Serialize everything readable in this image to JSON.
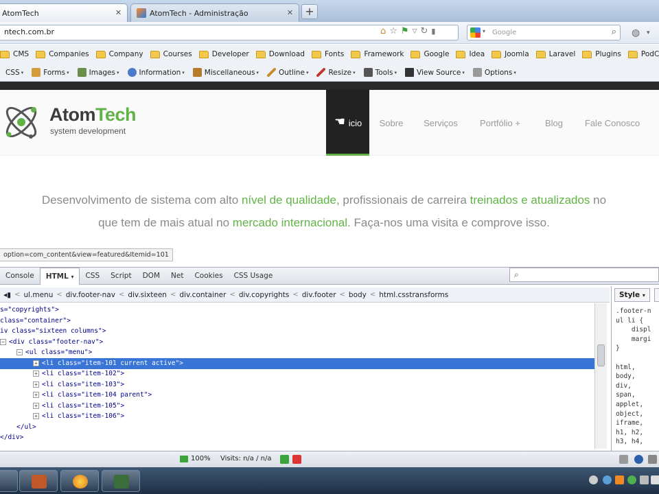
{
  "browser": {
    "tabs": [
      {
        "label": "AtomTech",
        "active": true
      },
      {
        "label": "AtomTech - Administração",
        "active": false
      }
    ],
    "new_tab": "+",
    "url": "ntech.com.br",
    "search_placeholder": "Google",
    "bookmarks": [
      "CMS",
      "Companies",
      "Company",
      "Courses",
      "Developer",
      "Download",
      "Fonts",
      "Framework",
      "Google",
      "Idea",
      "Joomla",
      "Laravel",
      "Plugins",
      "PodCast"
    ],
    "webdev_toolbar": [
      {
        "label": "CSS",
        "icon": "css-icon"
      },
      {
        "label": "Forms",
        "icon": "forms-icon"
      },
      {
        "label": "Images",
        "icon": "images-icon"
      },
      {
        "label": "Information",
        "icon": "information-icon"
      },
      {
        "label": "Miscellaneous",
        "icon": "miscellaneous-icon"
      },
      {
        "label": "Outline",
        "icon": "outline-icon"
      },
      {
        "label": "Resize",
        "icon": "resize-icon"
      },
      {
        "label": "Tools",
        "icon": "tools-icon"
      },
      {
        "label": "View Source",
        "icon": "view-source-icon"
      },
      {
        "label": "Options",
        "icon": "options-icon"
      }
    ]
  },
  "site": {
    "logo_title_dark": "Atom",
    "logo_title_green": "Tech",
    "logo_subtitle": "system development",
    "nav": [
      "Início",
      "Sobre",
      "Serviços",
      "Portfólio +",
      "Blog",
      "Fale Conosco"
    ],
    "nav_active_visible": "icio",
    "tagline": {
      "p1": "Desenvolvimento de sistema com alto ",
      "h1": "nível de qualidade",
      "p2": ", profissionais de carreira ",
      "h2": "treinados e atualizados",
      "p3": " no",
      "p4": "que tem de mais atual no ",
      "h3": "mercado internacional",
      "p5": ". Faça-nos uma visita e comprove isso."
    },
    "status_url": "option=com_content&view=featured&Itemid=101",
    "accent_color": "#62b347"
  },
  "firebug": {
    "tabs": [
      "Console",
      "HTML",
      "CSS",
      "Script",
      "DOM",
      "Net",
      "Cookies",
      "CSS Usage"
    ],
    "active_tab": "HTML",
    "breadcrumbs": [
      "ul.menu",
      "div.footer-nav",
      "div.sixteen",
      "div.container",
      "div.copyrights",
      "div.footer",
      "body",
      "html.csstransforms"
    ],
    "html_lines": [
      {
        "indent": 0,
        "expander": "",
        "text": "s=\"copyrights\">",
        "selected": false
      },
      {
        "indent": 0,
        "expander": "",
        "text": "class=\"container\">",
        "selected": false
      },
      {
        "indent": 0,
        "expander": "",
        "text": "iv class=\"sixteen columns\">",
        "selected": false
      },
      {
        "indent": 0,
        "expander": "−",
        "text": "<div class=\"footer-nav\">",
        "selected": false
      },
      {
        "indent": 1,
        "expander": "−",
        "text": "<ul class=\"menu\">",
        "selected": false
      },
      {
        "indent": 2,
        "expander": "+",
        "text": "<li class=\"item-101 current active\">",
        "selected": true
      },
      {
        "indent": 2,
        "expander": "+",
        "text": "<li class=\"item-102\">",
        "selected": false
      },
      {
        "indent": 2,
        "expander": "+",
        "text": "<li class=\"item-103\">",
        "selected": false
      },
      {
        "indent": 2,
        "expander": "+",
        "text": "<li class=\"item-104 parent\">",
        "selected": false
      },
      {
        "indent": 2,
        "expander": "+",
        "text": "<li class=\"item-105\">",
        "selected": false
      },
      {
        "indent": 2,
        "expander": "+",
        "text": "<li class=\"item-106\">",
        "selected": false
      },
      {
        "indent": 1,
        "expander": "",
        "text": "</ul>",
        "selected": false
      },
      {
        "indent": 0,
        "expander": "",
        "text": "</div>",
        "selected": false
      }
    ],
    "side_tab": "Style",
    "side_css": ".footer-n\nul li {\n    displ\n    margi\n}\n\nhtml,\nbody,\ndiv,\nspan,\napplet,\nobject,\niframe,\nh1, h2,\nh3, h4,",
    "status_zoom": "100%",
    "status_visits": "Visits: n/a / n/a"
  }
}
